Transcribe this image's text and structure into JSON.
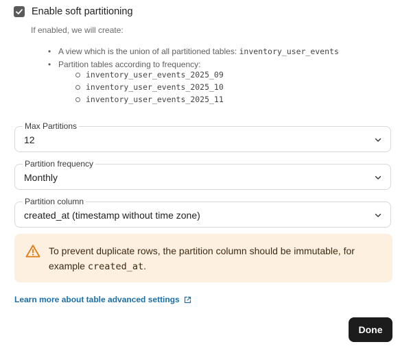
{
  "soft_partitioning": {
    "checkbox_label": "Enable soft partitioning",
    "checked": true,
    "help_text": "If enabled, we will create:",
    "view_text": "A view which is the union of all partitioned tables: ",
    "view_name": "inventory_user_events",
    "partitions_text": "Partition tables according to frequency:",
    "partition_tables": [
      "inventory_user_events_2025_09",
      "inventory_user_events_2025_10",
      "inventory_user_events_2025_11"
    ]
  },
  "fields": {
    "max_partitions": {
      "label": "Max Partitions",
      "value": "12"
    },
    "partition_frequency": {
      "label": "Partition frequency",
      "value": "Monthly"
    },
    "partition_column": {
      "label": "Partition column",
      "value": "created_at (timestamp without time zone)"
    }
  },
  "warning": {
    "text_before": "To prevent duplicate rows, the partition column should be immutable, for example ",
    "code": "created_at",
    "text_after": ".",
    "color": "#e07b10",
    "background": "#fdf0e1"
  },
  "learn_more": {
    "label": "Learn more about table advanced settings",
    "color": "#1a6fa8"
  },
  "done_button": {
    "label": "Done"
  }
}
